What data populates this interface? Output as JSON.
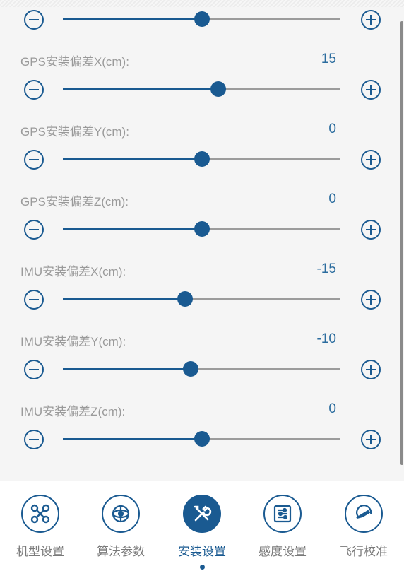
{
  "sliders": [
    {
      "label": "",
      "value": "",
      "level": 0.5
    },
    {
      "label": "GPS安装偏差X(cm):",
      "value": "15",
      "level": 0.56
    },
    {
      "label": "GPS安装偏差Y(cm):",
      "value": "0",
      "level": 0.5
    },
    {
      "label": "GPS安装偏差Z(cm):",
      "value": "0",
      "level": 0.5
    },
    {
      "label": "IMU安装偏差X(cm):",
      "value": "-15",
      "level": 0.44
    },
    {
      "label": "IMU安装偏差Y(cm):",
      "value": "-10",
      "level": 0.46
    },
    {
      "label": "IMU安装偏差Z(cm):",
      "value": "0",
      "level": 0.5
    }
  ],
  "nav": {
    "items": [
      {
        "label": "机型设置",
        "icon": "drone-icon"
      },
      {
        "label": "算法参数",
        "icon": "algorithm-icon"
      },
      {
        "label": "安装设置",
        "icon": "tools-icon",
        "active": true
      },
      {
        "label": "感度设置",
        "icon": "sensitivity-icon"
      },
      {
        "label": "飞行校准",
        "icon": "calibration-icon"
      }
    ]
  },
  "colors": {
    "accent": "#1a5a91",
    "value_text": "#2b6c9e",
    "label_text": "#9a9a9a"
  }
}
